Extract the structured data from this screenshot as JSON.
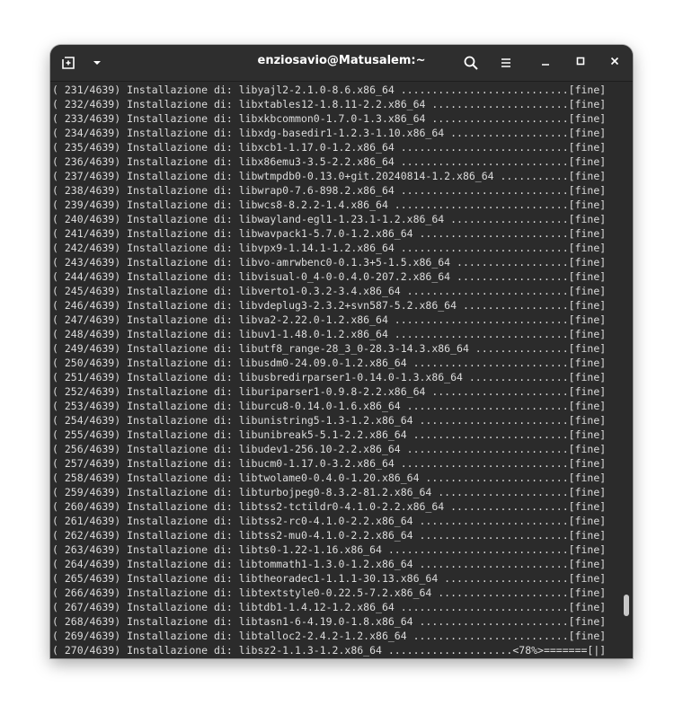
{
  "window": {
    "title": "enziosavio@Matusalem:~"
  },
  "icons": {
    "new_tab": "new-tab-icon",
    "dropdown": "chevron-down-icon",
    "search": "search-icon",
    "menu": "hamburger-menu-icon",
    "minimize": "minimize-icon",
    "maximize": "maximize-icon",
    "close": "close-icon"
  },
  "colors": {
    "background": "#2b2b2b",
    "titlebar": "#2e2e2e",
    "text": "#dcdcdc"
  },
  "terminal": {
    "lines": [
      "( 231/4639) Installazione di: libyajl2-2.1.0-8.6.x86_64 ...........................[fine]",
      "( 232/4639) Installazione di: libxtables12-1.8.11-2.2.x86_64 ......................[fine]",
      "( 233/4639) Installazione di: libxkbcommon0-1.7.0-1.3.x86_64 ......................[fine]",
      "( 234/4639) Installazione di: libxdg-basedir1-1.2.3-1.10.x86_64 ...................[fine]",
      "( 235/4639) Installazione di: libxcb1-1.17.0-1.2.x86_64 ...........................[fine]",
      "( 236/4639) Installazione di: libx86emu3-3.5-2.2.x86_64 ...........................[fine]",
      "( 237/4639) Installazione di: libwtmpdb0-0.13.0+git.20240814-1.2.x86_64 ...........[fine]",
      "( 238/4639) Installazione di: libwrap0-7.6-898.2.x86_64 ...........................[fine]",
      "( 239/4639) Installazione di: libwcs8-8.2.2-1.4.x86_64 ............................[fine]",
      "( 240/4639) Installazione di: libwayland-egl1-1.23.1-1.2.x86_64 ...................[fine]",
      "( 241/4639) Installazione di: libwavpack1-5.7.0-1.2.x86_64 ........................[fine]",
      "( 242/4639) Installazione di: libvpx9-1.14.1-1.2.x86_64 ...........................[fine]",
      "( 243/4639) Installazione di: libvo-amrwbenc0-0.1.3+5-1.5.x86_64 ..................[fine]",
      "( 244/4639) Installazione di: libvisual-0_4-0-0.4.0-207.2.x86_64 ..................[fine]",
      "( 245/4639) Installazione di: libverto1-0.3.2-3.4.x86_64 ..........................[fine]",
      "( 246/4639) Installazione di: libvdeplug3-2.3.2+svn587-5.2.x86_64 .................[fine]",
      "( 247/4639) Installazione di: libva2-2.22.0-1.2.x86_64 ............................[fine]",
      "( 248/4639) Installazione di: libuv1-1.48.0-1.2.x86_64 ............................[fine]",
      "( 249/4639) Installazione di: libutf8_range-28_3_0-28.3-14.3.x86_64 ...............[fine]",
      "( 250/4639) Installazione di: libusdm0-24.09.0-1.2.x86_64 .........................[fine]",
      "( 251/4639) Installazione di: libusbredirparser1-0.14.0-1.3.x86_64 ................[fine]",
      "( 252/4639) Installazione di: liburiparser1-0.9.8-2.2.x86_64 ......................[fine]",
      "( 253/4639) Installazione di: liburcu8-0.14.0-1.6.x86_64 ..........................[fine]",
      "( 254/4639) Installazione di: libunistring5-1.3-1.2.x86_64 ........................[fine]",
      "( 255/4639) Installazione di: libunibreak5-5.1-2.2.x86_64 .........................[fine]",
      "( 256/4639) Installazione di: libudev1-256.10-2.2.x86_64 ..........................[fine]",
      "( 257/4639) Installazione di: libucm0-1.17.0-3.2.x86_64 ...........................[fine]",
      "( 258/4639) Installazione di: libtwolame0-0.4.0-1.20.x86_64 .......................[fine]",
      "( 259/4639) Installazione di: libturbojpeg0-8.3.2-81.2.x86_64 .....................[fine]",
      "( 260/4639) Installazione di: libtss2-tctildr0-4.1.0-2.2.x86_64 ...................[fine]",
      "( 261/4639) Installazione di: libtss2-rc0-4.1.0-2.2.x86_64 ........................[fine]",
      "( 262/4639) Installazione di: libtss2-mu0-4.1.0-2.2.x86_64 ........................[fine]",
      "( 263/4639) Installazione di: libts0-1.22-1.16.x86_64 .............................[fine]",
      "( 264/4639) Installazione di: libtommath1-1.3.0-1.2.x86_64 ........................[fine]",
      "( 265/4639) Installazione di: libtheoradec1-1.1.1-30.13.x86_64 ....................[fine]",
      "( 266/4639) Installazione di: libtextstyle0-0.22.5-7.2.x86_64 .....................[fine]",
      "( 267/4639) Installazione di: libtdb1-1.4.12-1.2.x86_64 ...........................[fine]",
      "( 268/4639) Installazione di: libtasn1-6-4.19.0-1.8.x86_64 ........................[fine]",
      "( 269/4639) Installazione di: libtalloc2-2.4.2-1.2.x86_64 .........................[fine]",
      "( 270/4639) Installazione di: libsz2-1.1.3-1.2.x86_64 ....................<78%>=======[|]"
    ]
  }
}
